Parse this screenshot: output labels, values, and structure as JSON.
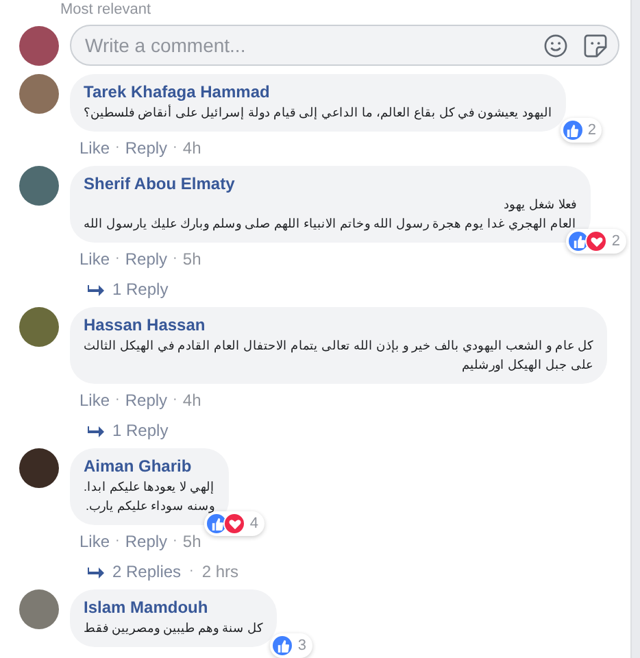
{
  "sort_label": "Most relevant",
  "composer": {
    "placeholder": "Write a comment..."
  },
  "comments": [
    {
      "name": "Tarek Khafaga Hammad",
      "lines": [
        "اليهود يعيشون في كل بقاع العالم، ما الداعي إلى قيام دولة إسرائيل على أنقاض فلسطين؟"
      ],
      "reactions": [
        {
          "kind": "like"
        }
      ],
      "reaction_count": "2",
      "actions": [
        {
          "kind": "link",
          "text": "Like"
        },
        {
          "kind": "sep",
          "text": "·"
        },
        {
          "kind": "link",
          "text": "Reply"
        },
        {
          "kind": "sep",
          "text": "·"
        },
        {
          "kind": "time",
          "text": "4h"
        }
      ]
    },
    {
      "name": "Sherif Abou Elmaty",
      "lines": [
        "فعلا شغل يهود",
        "العام الهجري غدا يوم هجرة رسول الله وخاتم الانبياء اللهم صلى وسلم وبارك عليك يارسول الله"
      ],
      "reactions": [
        {
          "kind": "like"
        },
        {
          "kind": "love"
        }
      ],
      "reaction_count": "2",
      "actions": [
        {
          "kind": "link",
          "text": "Like"
        },
        {
          "kind": "sep",
          "text": "·"
        },
        {
          "kind": "link",
          "text": "Reply"
        },
        {
          "kind": "sep",
          "text": "·"
        },
        {
          "kind": "time",
          "text": "5h"
        }
      ],
      "replies": [
        {
          "kind": "link",
          "text": "1 Reply"
        }
      ]
    },
    {
      "name": "Hassan Hassan",
      "lines": [
        "كل عام و الشعب اليهودي بالف خير و بإذن الله تعالى يتمام الاحتفال العام القادم في الهيكل الثالث",
        "على جبل الهيكل اورشليم"
      ],
      "actions": [
        {
          "kind": "link",
          "text": "Like"
        },
        {
          "kind": "sep",
          "text": "·"
        },
        {
          "kind": "link",
          "text": "Reply"
        },
        {
          "kind": "sep",
          "text": "·"
        },
        {
          "kind": "time",
          "text": "4h"
        }
      ],
      "replies": [
        {
          "kind": "link",
          "text": "1 Reply"
        }
      ]
    },
    {
      "name": "Aiman Gharib",
      "lines": [
        "إلهي لا يعودها عليكم ابدا.",
        "وسنه سوداء عليكم يارب."
      ],
      "reactions": [
        {
          "kind": "like"
        },
        {
          "kind": "love"
        }
      ],
      "reaction_count": "4",
      "actions": [
        {
          "kind": "link",
          "text": "Like"
        },
        {
          "kind": "sep",
          "text": "·"
        },
        {
          "kind": "link",
          "text": "Reply"
        },
        {
          "kind": "sep",
          "text": "·"
        },
        {
          "kind": "time",
          "text": "5h"
        }
      ],
      "replies": [
        {
          "kind": "link",
          "text": "2 Replies"
        },
        {
          "kind": "sep",
          "text": "·"
        },
        {
          "kind": "time",
          "text": "2 hrs"
        }
      ]
    },
    {
      "name": "Islam Mamdouh",
      "lines": [
        "كل سنة وهم طيبين ومصريين فقط"
      ],
      "reactions": [
        {
          "kind": "like"
        }
      ],
      "reaction_count": "3"
    }
  ]
}
